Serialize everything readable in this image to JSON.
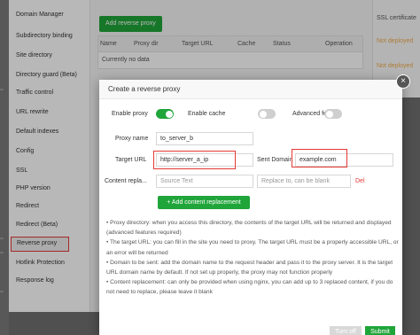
{
  "sidebar": {
    "items": [
      {
        "label": "Domain Manager"
      },
      {
        "label": "Subdirectory binding"
      },
      {
        "label": "Site directory"
      },
      {
        "label": "Directory guard (Beta)"
      },
      {
        "label": "Traffic control"
      },
      {
        "label": "URL rewrite"
      },
      {
        "label": "Default indexes"
      },
      {
        "label": "Config"
      },
      {
        "label": "SSL"
      },
      {
        "label": "PHP version"
      },
      {
        "label": "Redirect"
      },
      {
        "label": "Redirect (Beta)"
      },
      {
        "label": "Reverse proxy"
      },
      {
        "label": "Hotlink Protection"
      },
      {
        "label": "Response log"
      }
    ]
  },
  "main": {
    "add_button": "Add reverse proxy",
    "table": {
      "headers": [
        "Name",
        "Proxy dir",
        "Target URL",
        "Cache",
        "Status",
        "Operation"
      ],
      "empty_text": "Currently no data"
    }
  },
  "ssl_panel": {
    "header": "SSL certificate",
    "rows": [
      "Not deployed",
      "Not deployed"
    ],
    "status_color": "#f0ad4e"
  },
  "modal": {
    "title": "Create a reverse proxy",
    "close_icon": "close-icon",
    "enable_proxy": {
      "label": "Enable proxy",
      "on": true
    },
    "enable_cache": {
      "label": "Enable cache",
      "on": false
    },
    "advanced_feature": {
      "label": "Advanced feature",
      "on": false
    },
    "proxy_name": {
      "label": "Proxy name",
      "value": "to_server_b"
    },
    "target_url": {
      "label": "Target URL",
      "value": "http://server_a_ip"
    },
    "sent_domain": {
      "label": "Sent Domain",
      "value": "example.com"
    },
    "content_replace": {
      "label": "Content repla...",
      "source_placeholder": "Source Text",
      "replace_placeholder": "Replace to, can be blank",
      "del_label": "Del"
    },
    "add_replacement_button": "+ Add content replacement",
    "notes": [
      "Proxy directory: when you access this directory, the contents of the target URL will be returned and displayed (advanced features required)",
      "The target URL: you can fill in the site you need to proxy. The target URL must be a properly accessible URL, or an error will be returned",
      "Domain to be sent: add the domain name to the request header and pass it to the proxy server. It is the target URL domain name by default. If not set up properly, the proxy may not function properly",
      "Content replacement: can only be provided when using nginx, you can add up to 3 replaced content, if you do not need to replace, please leave it blank"
    ],
    "turn_off_button": "Turn off",
    "submit_button": "Submit"
  },
  "colors": {
    "accent_green": "#20a53a",
    "highlight_red": "#e53935"
  }
}
